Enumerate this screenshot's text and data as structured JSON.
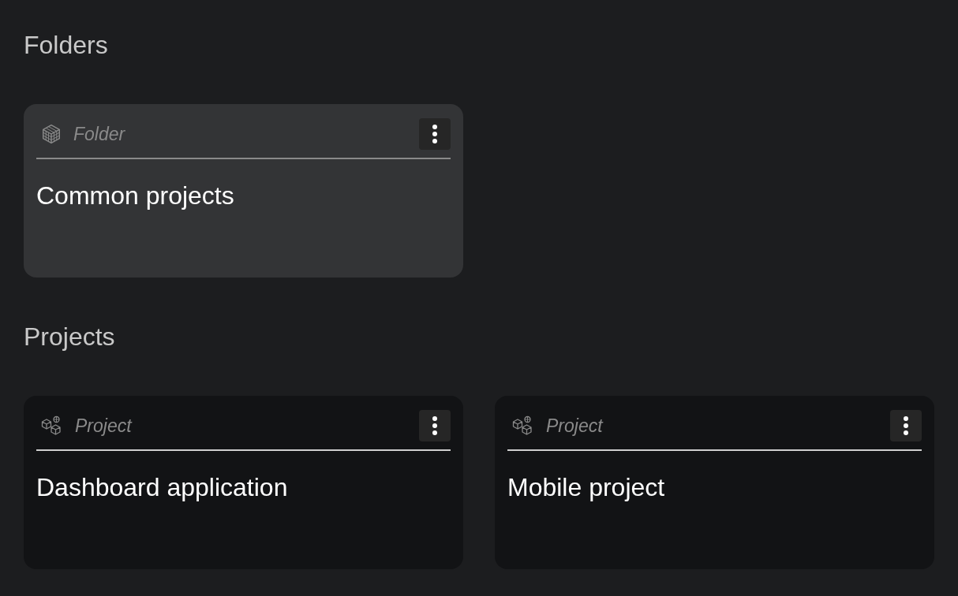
{
  "sections": [
    {
      "title": "Folders",
      "cards": [
        {
          "kind": "folder",
          "type_label": "Folder",
          "title": "Common projects"
        }
      ]
    },
    {
      "title": "Projects",
      "cards": [
        {
          "kind": "project",
          "type_label": "Project",
          "title": "Dashboard application"
        },
        {
          "kind": "project",
          "type_label": "Project",
          "title": "Mobile project"
        }
      ]
    }
  ]
}
